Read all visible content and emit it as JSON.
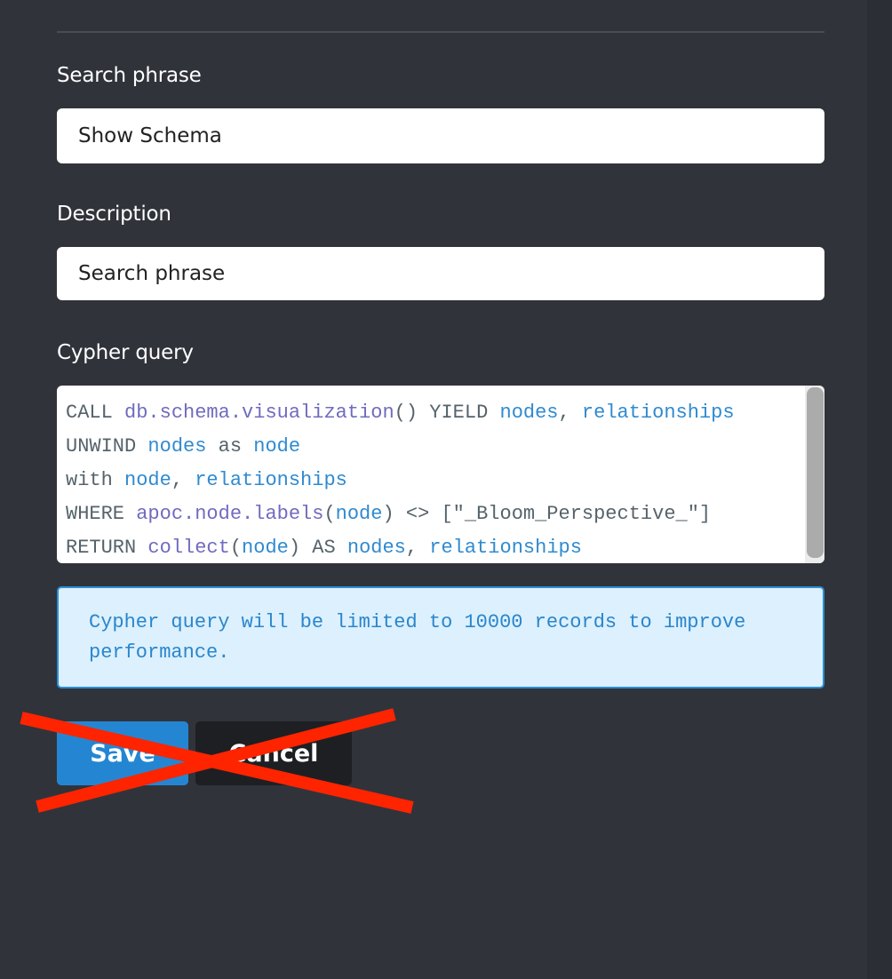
{
  "form": {
    "search_phrase": {
      "label": "Search phrase",
      "value": "Show Schema"
    },
    "description": {
      "label": "Description",
      "value": "Search phrase"
    },
    "cypher_query": {
      "label": "Cypher query",
      "lines": [
        [
          {
            "t": "CALL ",
            "k": "kw"
          },
          {
            "t": "db.schema.visualization",
            "k": "fn"
          },
          {
            "t": "() YIELD ",
            "k": "kw"
          },
          {
            "t": "nodes",
            "k": "var"
          },
          {
            "t": ", ",
            "k": "kw"
          },
          {
            "t": "relationships",
            "k": "var"
          }
        ],
        [
          {
            "t": "UNWIND ",
            "k": "kw"
          },
          {
            "t": "nodes",
            "k": "var"
          },
          {
            "t": " as ",
            "k": "kw"
          },
          {
            "t": "node",
            "k": "var"
          }
        ],
        [
          {
            "t": "with ",
            "k": "kw"
          },
          {
            "t": "node",
            "k": "var"
          },
          {
            "t": ", ",
            "k": "kw"
          },
          {
            "t": "relationships",
            "k": "var"
          }
        ],
        [
          {
            "t": "WHERE ",
            "k": "kw"
          },
          {
            "t": "apoc.node.labels",
            "k": "fn"
          },
          {
            "t": "(",
            "k": "kw"
          },
          {
            "t": "node",
            "k": "var"
          },
          {
            "t": ") <> [\"_Bloom_Perspective_\"]",
            "k": "str"
          }
        ],
        [
          {
            "t": "RETURN ",
            "k": "kw"
          },
          {
            "t": "collect",
            "k": "fn"
          },
          {
            "t": "(",
            "k": "kw"
          },
          {
            "t": "node",
            "k": "var"
          },
          {
            "t": ") AS ",
            "k": "kw"
          },
          {
            "t": "nodes",
            "k": "var"
          },
          {
            "t": ", ",
            "k": "kw"
          },
          {
            "t": "relationships",
            "k": "var"
          }
        ]
      ]
    },
    "info_message": "Cypher query will be limited to 10000 records to improve performance.",
    "buttons": {
      "save_label": "Save",
      "cancel_label": "Cancel"
    }
  },
  "annotation": {
    "cross_color": "#ff2400",
    "meaning": "crossed-out"
  },
  "colors": {
    "background": "#31333b",
    "save_button": "#2486d2",
    "cancel_button": "#1e1f23",
    "info_background": "#dcf0fd",
    "info_border": "#2a8fd6",
    "code_keyword": "#55636b",
    "code_function": "#6f6bbf",
    "code_variable": "#2f8ad0"
  }
}
